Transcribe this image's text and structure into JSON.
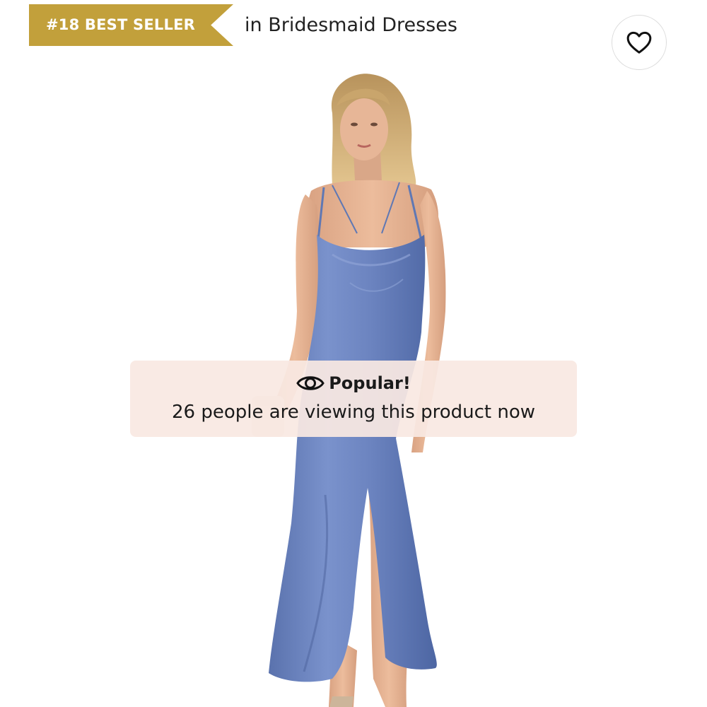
{
  "badge": {
    "label": "#18 BEST SELLER",
    "color": "#c2a03b"
  },
  "category": {
    "text": "in Bridesmaid Dresses"
  },
  "favorite_button": {
    "icon": "heart-outline-icon"
  },
  "product_image": {
    "dress_color": "#6e86bf"
  },
  "popularity": {
    "icon": "eye-icon",
    "title": "Popular!",
    "message": "26 people are viewing this product now",
    "background": "#f9e8e2"
  }
}
